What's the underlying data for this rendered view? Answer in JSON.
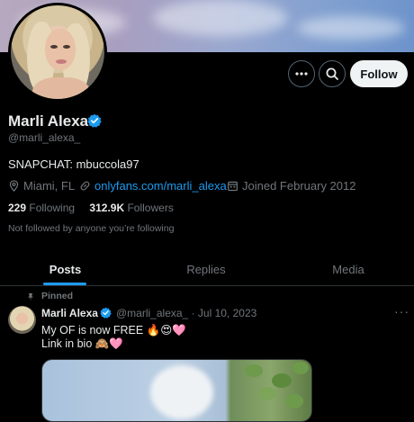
{
  "profile": {
    "name": "Marli Alexa",
    "handle": "@marli_alexa_",
    "bio": "SNAPCHAT: mbuccola97",
    "location": "Miami, FL",
    "website": "onlyfans.com/marli_alexa",
    "joined": "Joined February 2012",
    "following_count": "229",
    "following_label": "Following",
    "followers_count": "312.9K",
    "followers_label": "Followers",
    "not_followed_text": "Not followed by anyone you’re following"
  },
  "actions": {
    "follow_label": "Follow",
    "more_icon": "more-icon",
    "search_icon": "search-icon"
  },
  "tabs": [
    {
      "label": "Posts"
    },
    {
      "label": "Replies"
    },
    {
      "label": "Media"
    }
  ],
  "pinned_tweet": {
    "pinned_label": "Pinned",
    "author_name": "Marli Alexa",
    "author_handle": "@marli_alexa_",
    "date_sep": "·",
    "date": "Jul 10, 2023",
    "more": "···",
    "line1": "My OF is now FREE 🔥😍🩷",
    "line2": "Link in bio 🙈🩷"
  },
  "colors": {
    "accent": "#1d9bf0",
    "background": "#000000",
    "muted_text": "#71767b",
    "primary_text": "#e7e9ea",
    "follow_button_bg": "#eff3f4"
  }
}
